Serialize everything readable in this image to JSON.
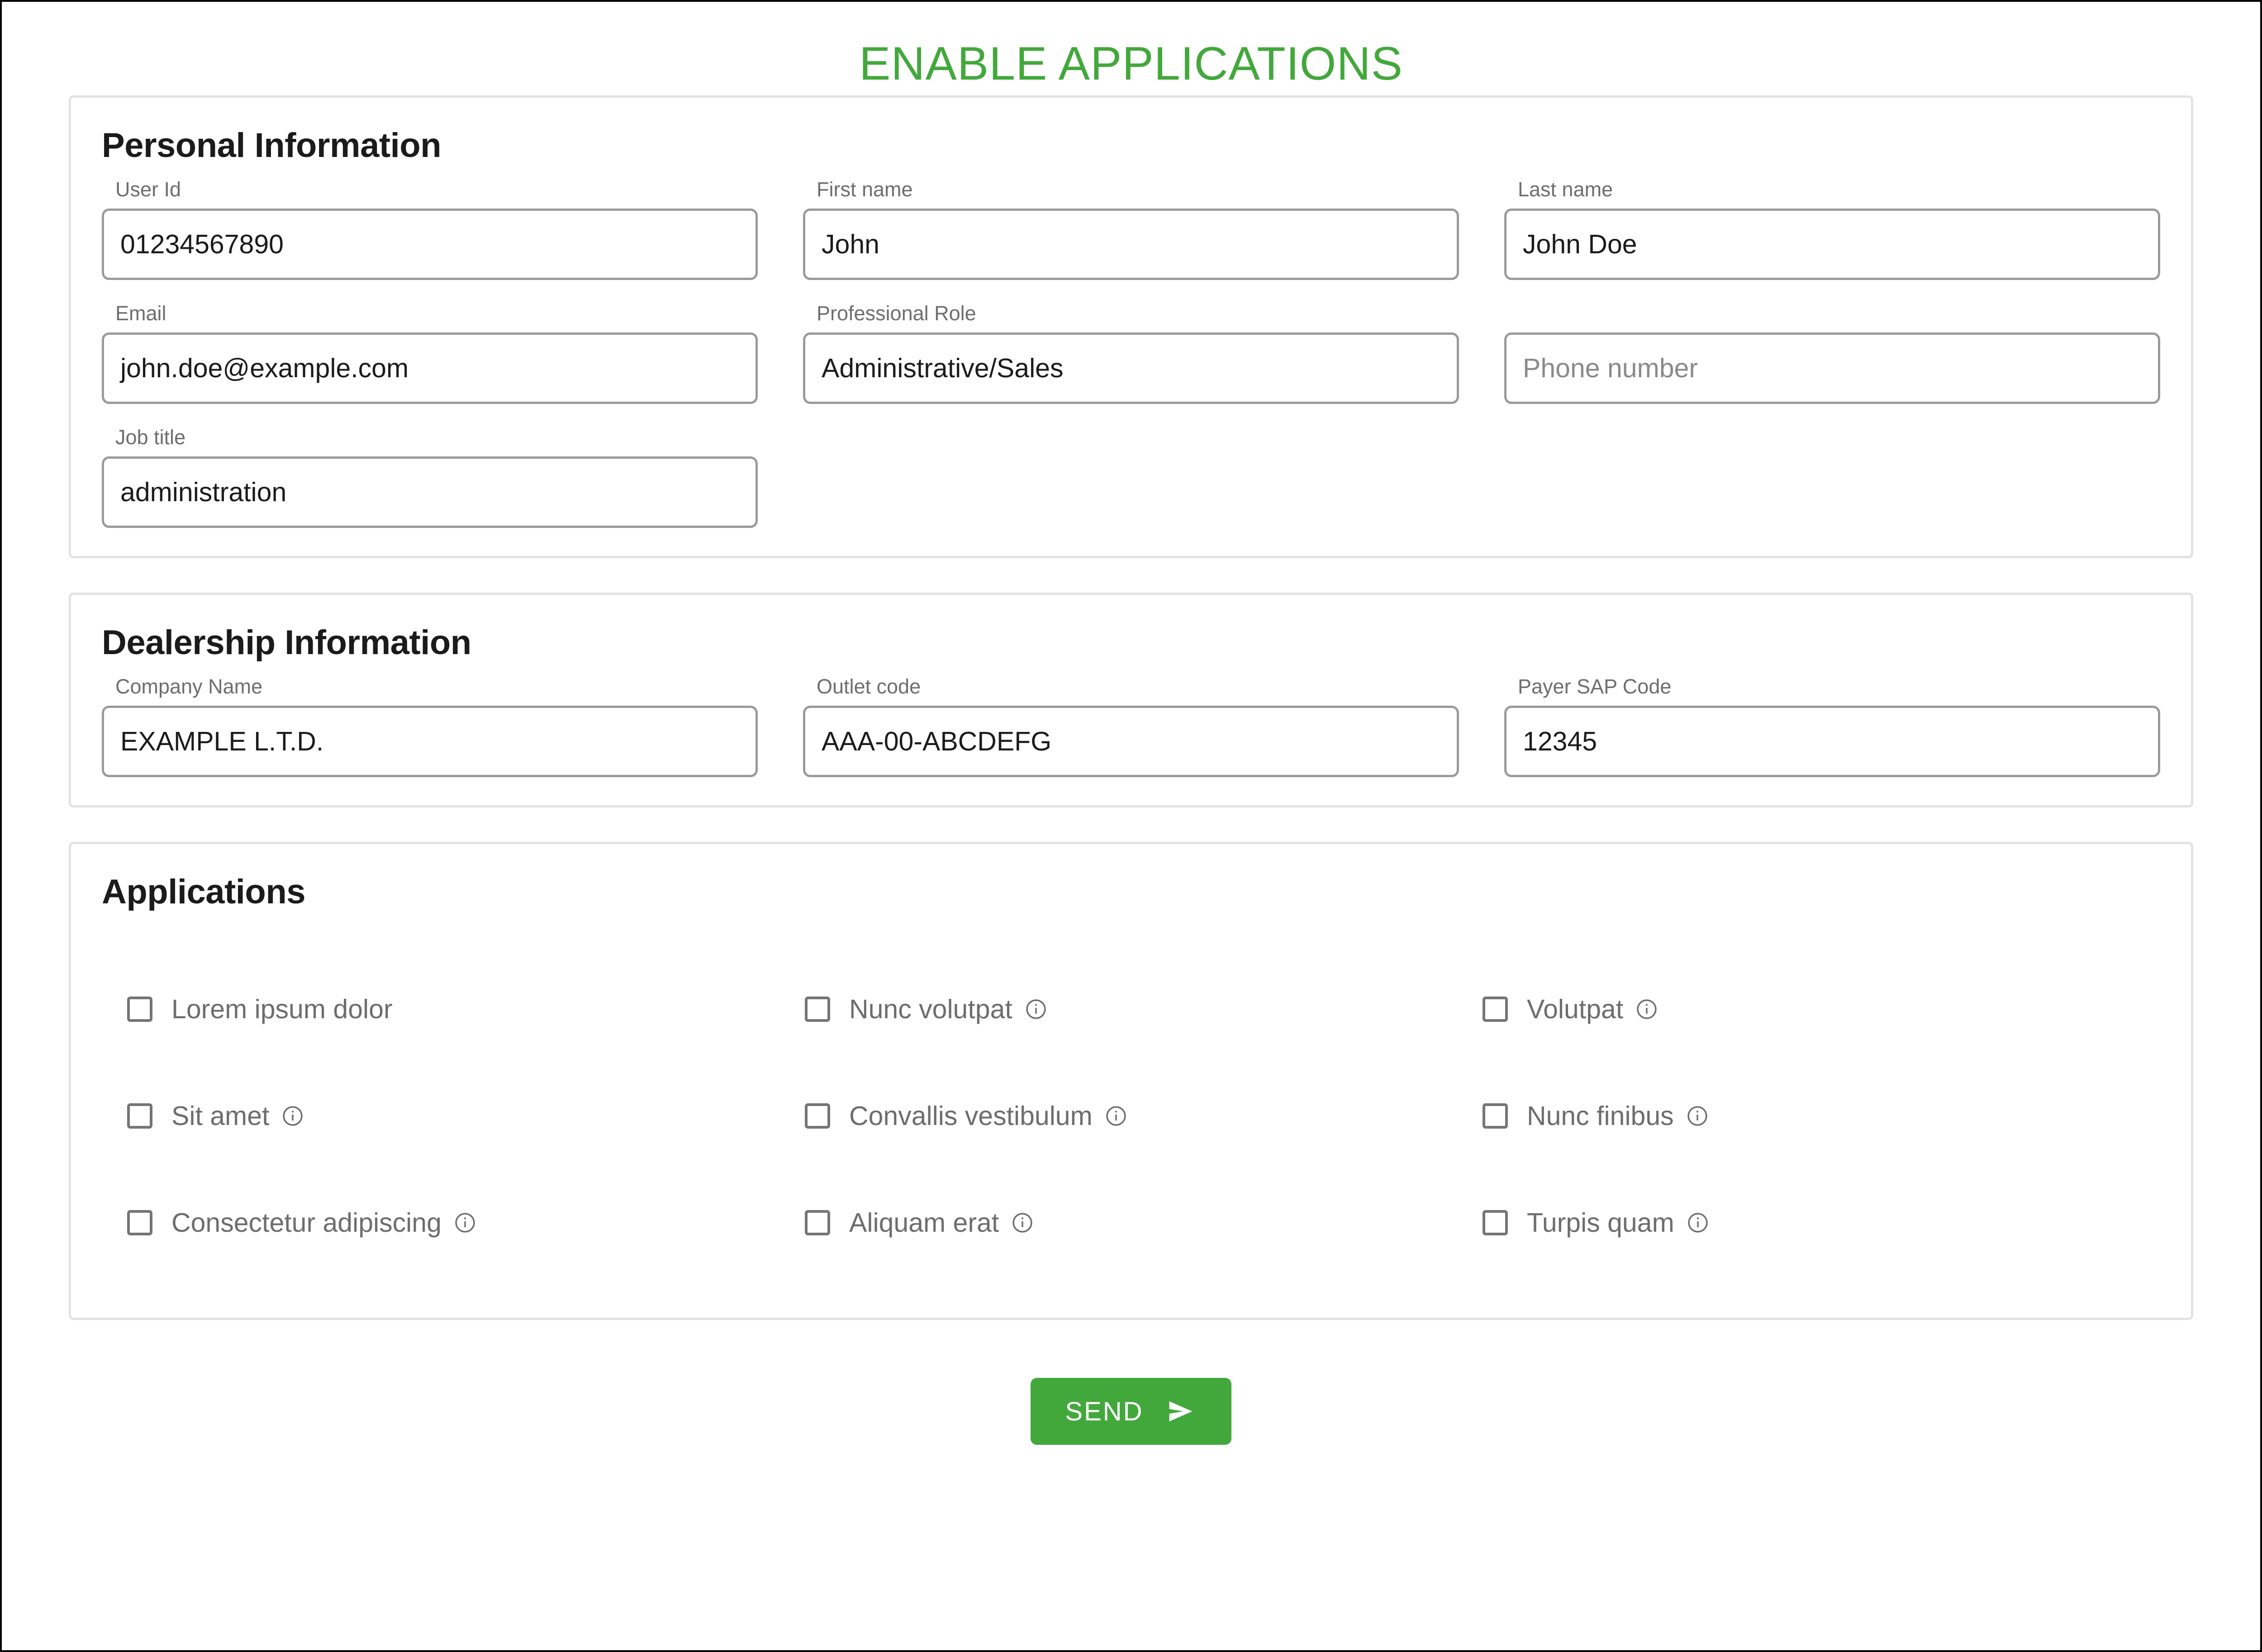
{
  "page": {
    "title": "ENABLE APPLICATIONS",
    "accent_color": "#43a83c",
    "card_border_color": "#e2e2e2",
    "input_border_color": "#9a9a9a",
    "label_color": "#6e6e6e"
  },
  "personal_information": {
    "section_title": "Personal Information",
    "fields": [
      {
        "label": "User Id",
        "value": "01234567890",
        "placeholder": "",
        "is_placeholder": false
      },
      {
        "label": "First name",
        "value": "John",
        "placeholder": "",
        "is_placeholder": false
      },
      {
        "label": "Last name",
        "value": "John Doe",
        "placeholder": "",
        "is_placeholder": false
      },
      {
        "label": "Email",
        "value": "john.doe@example.com",
        "placeholder": "",
        "is_placeholder": false
      },
      {
        "label": "Professional Role",
        "value": "Administrative/Sales",
        "placeholder": "",
        "is_placeholder": false
      },
      {
        "label": "",
        "value": "Phone number",
        "placeholder": "Phone number",
        "is_placeholder": true
      },
      {
        "label": "Job title",
        "value": "administration",
        "placeholder": "",
        "is_placeholder": false
      }
    ]
  },
  "dealership_information": {
    "section_title": "Dealership Information",
    "fields": [
      {
        "label": "Company Name",
        "value": "EXAMPLE L.T.D.",
        "placeholder": "",
        "is_placeholder": false
      },
      {
        "label": "Outlet code",
        "value": "AAA-00-ABCDEFG",
        "placeholder": "",
        "is_placeholder": false
      },
      {
        "label": "Payer SAP Code",
        "value": "12345",
        "placeholder": "",
        "is_placeholder": false
      }
    ]
  },
  "applications": {
    "section_title": "Applications",
    "items": [
      {
        "label": "Lorem ipsum dolor",
        "checked": false,
        "has_info": false,
        "info_icon": "info-circle-icon"
      },
      {
        "label": "Nunc volutpat",
        "checked": false,
        "has_info": true,
        "info_icon": "info-circle-icon"
      },
      {
        "label": "Volutpat",
        "checked": false,
        "has_info": true,
        "info_icon": "info-circle-icon"
      },
      {
        "label": "Sit amet",
        "checked": false,
        "has_info": true,
        "info_icon": "info-circle-icon"
      },
      {
        "label": "Convallis vestibulum",
        "checked": false,
        "has_info": true,
        "info_icon": "info-circle-icon"
      },
      {
        "label": "Nunc finibus",
        "checked": false,
        "has_info": true,
        "info_icon": "info-circle-icon"
      },
      {
        "label": "Consectetur adipiscing",
        "checked": false,
        "has_info": true,
        "info_icon": "info-circle-icon"
      },
      {
        "label": "Aliquam erat",
        "checked": false,
        "has_info": true,
        "info_icon": "info-circle-icon"
      },
      {
        "label": "Turpis quam",
        "checked": false,
        "has_info": true,
        "info_icon": "info-circle-icon"
      }
    ]
  },
  "footer": {
    "send_label": "SEND",
    "send_icon": "send-arrow-icon",
    "send_color": "#43a83c"
  }
}
